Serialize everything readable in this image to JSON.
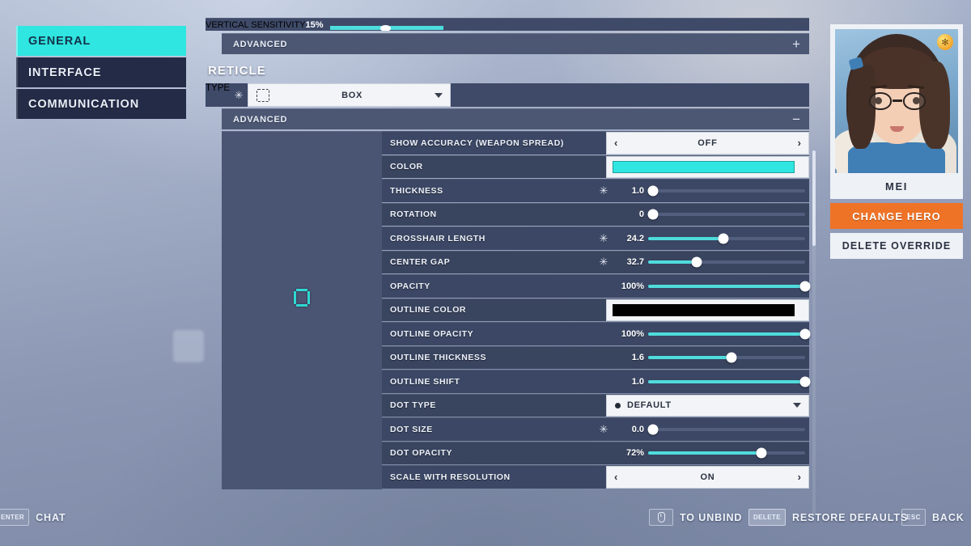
{
  "nav": {
    "items": [
      {
        "label": "GENERAL",
        "active": true
      },
      {
        "label": "INTERFACE",
        "active": false
      },
      {
        "label": "COMMUNICATION",
        "active": false
      }
    ]
  },
  "settings": {
    "cropped_row": {
      "label": "VERTICAL SENSITIVITY",
      "value": "15%"
    },
    "top_advanced": {
      "label": "ADVANCED",
      "sign": "+"
    },
    "section_title": "RETICLE",
    "type_row": {
      "label": "TYPE",
      "modified_marker": "✳",
      "value": "BOX",
      "icon": "reticle-box-icon"
    },
    "advanced_header": {
      "label": "ADVANCED",
      "sign": "−"
    },
    "options": [
      {
        "name": "SHOW ACCURACY (WEAPON SPREAD)",
        "control": "stepper",
        "value": "OFF",
        "left_arrow": "‹",
        "right_arrow": "›"
      },
      {
        "name": "COLOR",
        "control": "color",
        "swatch": "#2fe6e0"
      },
      {
        "name": "THICKNESS",
        "control": "slider",
        "modified_marker": "✳",
        "value": "1.0",
        "percent": 3
      },
      {
        "name": "ROTATION",
        "control": "slider",
        "value": "0",
        "percent": 3
      },
      {
        "name": "CROSSHAIR LENGTH",
        "control": "slider",
        "modified_marker": "✳",
        "value": "24.2",
        "percent": 48
      },
      {
        "name": "CENTER GAP",
        "control": "slider",
        "modified_marker": "✳",
        "value": "32.7",
        "percent": 31
      },
      {
        "name": "OPACITY",
        "control": "slider",
        "value": "100%",
        "percent": 100
      },
      {
        "name": "OUTLINE COLOR",
        "control": "color",
        "swatch": "#000000"
      },
      {
        "name": "OUTLINE OPACITY",
        "control": "slider",
        "value": "100%",
        "percent": 100
      },
      {
        "name": "OUTLINE THICKNESS",
        "control": "slider",
        "value": "1.6",
        "percent": 53
      },
      {
        "name": "OUTLINE SHIFT",
        "control": "slider",
        "value": "1.0",
        "percent": 100
      },
      {
        "name": "DOT TYPE",
        "control": "dropdown",
        "value": "DEFAULT",
        "icon": "dot-icon"
      },
      {
        "name": "DOT SIZE",
        "control": "slider",
        "modified_marker": "✳",
        "value": "0.0",
        "percent": 3
      },
      {
        "name": "DOT OPACITY",
        "control": "slider",
        "value": "72%",
        "percent": 72
      },
      {
        "name": "SCALE WITH RESOLUTION",
        "control": "stepper",
        "value": "ON",
        "left_arrow": "‹",
        "right_arrow": "›"
      }
    ]
  },
  "hero": {
    "name": "MEI",
    "change_button": "CHANGE HERO",
    "delete_button": "DELETE OVERRIDE"
  },
  "bottom_bar": {
    "chat": {
      "key": "ENTER",
      "label": "CHAT"
    },
    "unbind": {
      "key": "mouse-icon",
      "label": "TO UNBIND"
    },
    "restore": {
      "key": "DELETE",
      "label": "RESTORE DEFAULTS"
    },
    "back": {
      "key": "ESC",
      "label": "BACK"
    }
  },
  "colors": {
    "accent_cyan": "#2fe6e0",
    "orange": "#ef7327",
    "row_dark": "#3b4764",
    "panel_light": "#f2f4f7"
  }
}
